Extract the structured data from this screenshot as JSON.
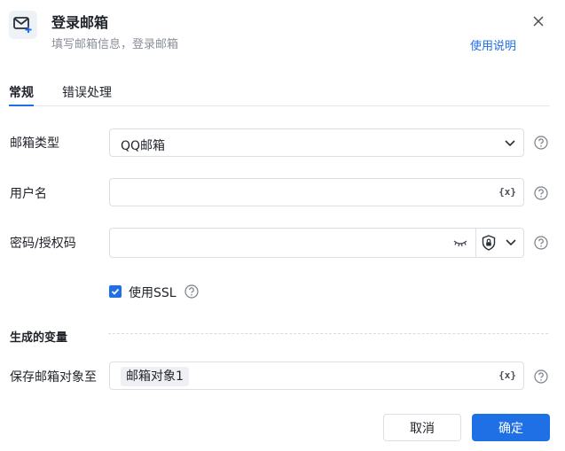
{
  "header": {
    "title": "登录邮箱",
    "subtitle": "填写邮箱信息，登录邮箱",
    "help_link": "使用说明",
    "app_icon": "mail-add-icon",
    "close_icon": "close-icon"
  },
  "tabs": [
    {
      "label": "常规",
      "active": true
    },
    {
      "label": "错误处理",
      "active": false
    }
  ],
  "form": {
    "mailbox_type": {
      "label": "邮箱类型",
      "value": "QQ邮箱"
    },
    "username": {
      "label": "用户名",
      "value": "",
      "var_icon": "{x}"
    },
    "password": {
      "label": "密码/授权码",
      "value": ""
    },
    "use_ssl": {
      "label": "使用SSL",
      "checked": true
    }
  },
  "generated": {
    "section_title": "生成的变量",
    "save_label": "保存邮箱对象至",
    "save_value": "邮箱对象1",
    "var_icon": "{x}"
  },
  "footer": {
    "cancel_label": "取消",
    "ok_label": "确定"
  },
  "colors": {
    "accent": "#1f6fe5",
    "border": "#dcdfe6",
    "muted_text": "#8a9099"
  }
}
